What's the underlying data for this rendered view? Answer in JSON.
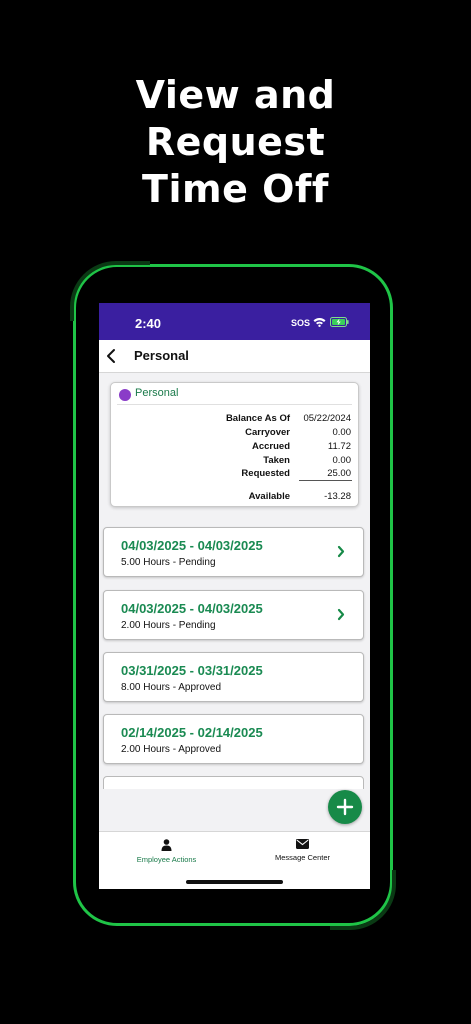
{
  "promo": {
    "line1": "View and",
    "line2": "Request",
    "line3": "Time Off"
  },
  "status_bar": {
    "time": "2:40",
    "sos": "SOS",
    "icons": [
      "wifi-icon",
      "battery-charging-icon"
    ]
  },
  "nav": {
    "title": "Personal",
    "back_icon": "chevron-left-icon"
  },
  "balance": {
    "plan_name": "Personal",
    "plan_color": "#8a3cc8",
    "rows": [
      {
        "label": "Balance As Of",
        "value": "05/22/2024"
      },
      {
        "label": "Carryover",
        "value": "0.00"
      },
      {
        "label": "Accrued",
        "value": "11.72"
      },
      {
        "label": "Taken",
        "value": "0.00"
      },
      {
        "label": "Requested",
        "value": "25.00"
      },
      {
        "label": "Available",
        "value": "-13.28"
      }
    ]
  },
  "requests": [
    {
      "dates": "04/03/2025 - 04/03/2025",
      "detail": "5.00 Hours - Pending",
      "has_chevron": true
    },
    {
      "dates": "04/03/2025 - 04/03/2025",
      "detail": "2.00 Hours - Pending",
      "has_chevron": true
    },
    {
      "dates": "03/31/2025 - 03/31/2025",
      "detail": "8.00 Hours - Approved",
      "has_chevron": false
    },
    {
      "dates": "02/14/2025 - 02/14/2025",
      "detail": "2.00 Hours - Approved",
      "has_chevron": false
    }
  ],
  "fab": {
    "icon": "plus-icon"
  },
  "tabs": [
    {
      "label": "Employee Actions",
      "icon": "person-icon",
      "active": true
    },
    {
      "label": "Message Center",
      "icon": "envelope-icon",
      "active": false
    }
  ],
  "colors": {
    "accent_green": "#1a8a52",
    "status_bar_purple": "#3a1fa0",
    "frame_green": "#1fc447",
    "active_tab": "#1a7a4a"
  }
}
